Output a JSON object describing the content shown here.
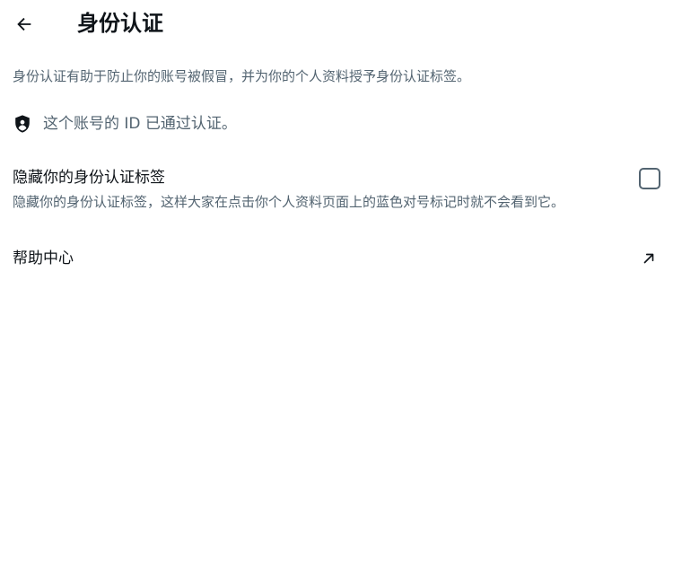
{
  "header": {
    "title": "身份认证",
    "back_icon": "arrow-left-icon"
  },
  "description": "身份认证有助于防止你的账号被假冒，并为你的个人资料授予身份认证标签。",
  "verified": {
    "icon": "shield-check-icon",
    "text": "这个账号的 ID 已通过认证。"
  },
  "hide_badge": {
    "label": "隐藏你的身份认证标签",
    "hint": "隐藏你的身份认证标签，这样大家在点击你个人资料页面上的蓝色对号标记时就不会看到它。",
    "checked": false
  },
  "help": {
    "label": "帮助中心",
    "icon": "external-link-arrow-icon"
  },
  "colors": {
    "primary_text": "#0f1419",
    "secondary_text": "#536471",
    "background": "#ffffff"
  }
}
